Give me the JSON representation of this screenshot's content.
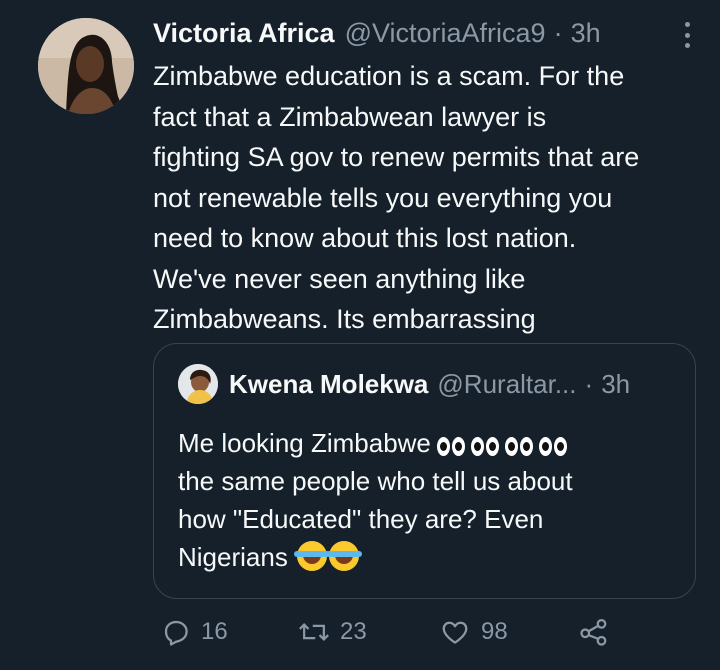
{
  "tweet": {
    "author_name": "Victoria Africa",
    "author_handle": "@VictoriaAfrica9",
    "separator": "·",
    "time": "3h",
    "text_lines": [
      "Zimbabwe education is a scam. For the",
      "fact that a Zimbabwean lawyer is",
      "fighting SA gov to renew permits that are",
      "not renewable tells you everything you",
      "need to know about this lost nation.",
      "We've never seen anything like",
      "Zimbabweans. Its embarrassing"
    ]
  },
  "quote": {
    "author_name": "Kwena Molekwa",
    "author_handle": "@Ruraltar...",
    "separator": "·",
    "time": "3h",
    "line1": "Me looking Zimbabwe",
    "line2": "the same people who tell us about",
    "line3": "how \"Educated\" they are? Even",
    "line4": "Nigerians",
    "emoji_eyes_count": 4,
    "emoji_laugh_count": 2
  },
  "actions": {
    "reply_count": "16",
    "retweet_count": "23",
    "like_count": "98"
  },
  "icons": {
    "reply": "reply-icon",
    "retweet": "retweet-icon",
    "like": "like-icon",
    "share": "share-icon",
    "more": "more-icon"
  },
  "colors": {
    "background": "#15202b",
    "text": "#f7f9f9",
    "secondary": "#8b98a5",
    "border": "#38444d"
  }
}
